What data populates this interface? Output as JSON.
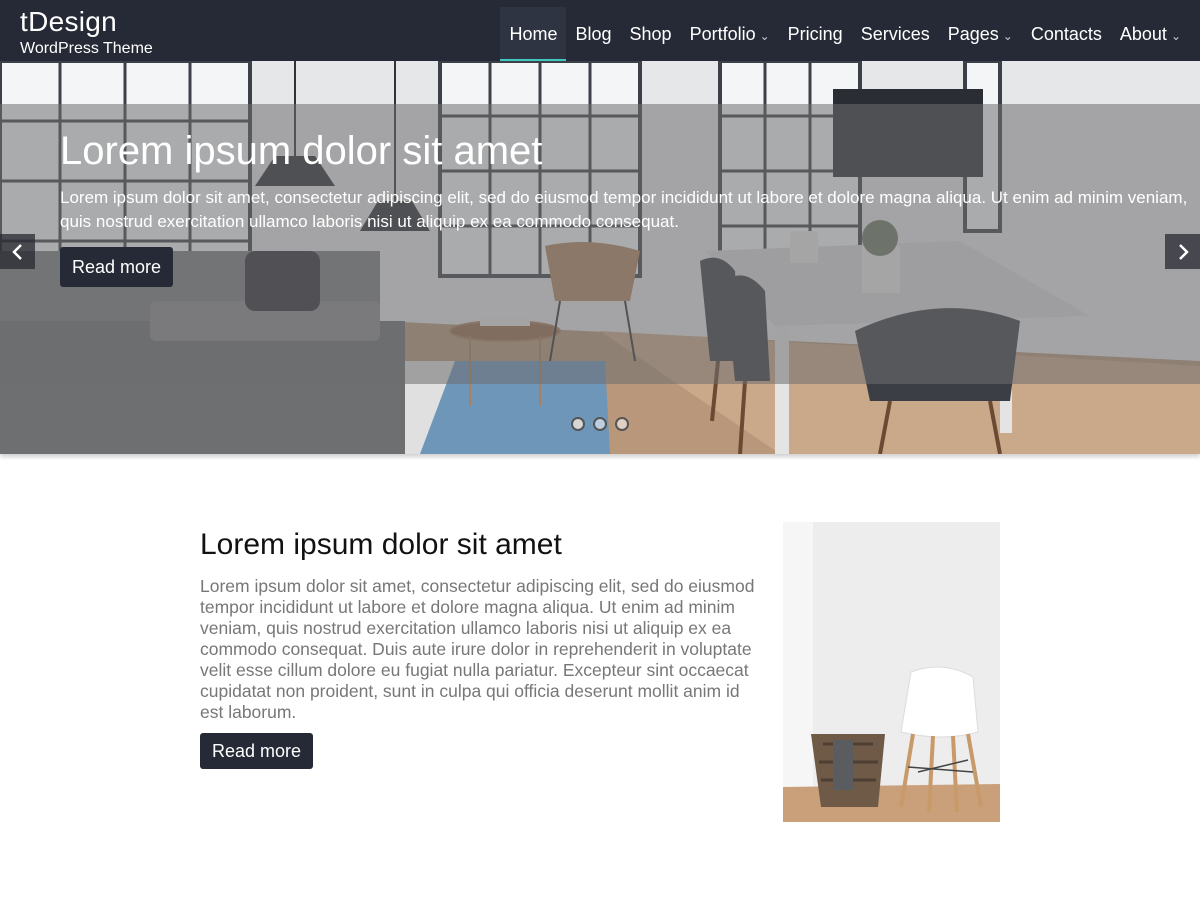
{
  "site": {
    "title": "tDesign",
    "tagline": "WordPress Theme"
  },
  "nav": {
    "items": [
      {
        "label": "Home",
        "active": true,
        "has_dropdown": false
      },
      {
        "label": "Blog",
        "active": false,
        "has_dropdown": false
      },
      {
        "label": "Shop",
        "active": false,
        "has_dropdown": false
      },
      {
        "label": "Portfolio",
        "active": false,
        "has_dropdown": true
      },
      {
        "label": "Pricing",
        "active": false,
        "has_dropdown": false
      },
      {
        "label": "Services",
        "active": false,
        "has_dropdown": false
      },
      {
        "label": "Pages",
        "active": false,
        "has_dropdown": true
      },
      {
        "label": "Contacts",
        "active": false,
        "has_dropdown": false
      },
      {
        "label": "About",
        "active": false,
        "has_dropdown": true
      }
    ],
    "dropdown_icon": "chevron-down-icon"
  },
  "slider": {
    "title": "Lorem ipsum dolor sit amet",
    "text": "Lorem ipsum dolor sit amet, consectetur adipiscing elit, sed do eiusmod tempor incididunt ut labore et dolore magna aliqua. Ut enim ad minim veniam, quis nostrud exercitation ullamco laboris nisi ut aliquip ex ea commodo consequat.",
    "button_label": "Read more",
    "prev_icon": "chevron-left-icon",
    "next_icon": "chevron-right-icon",
    "slide_count": 3,
    "active_slide": 1,
    "image": "living-room-dining-table"
  },
  "feature": {
    "title": "Lorem ipsum dolor sit amet",
    "text": "Lorem ipsum dolor sit amet, consectetur adipiscing elit, sed do eiusmod tempor incididunt ut labore et dolore magna aliqua. Ut enim ad minim veniam, quis nostrud exercitation ullamco laboris nisi ut aliquip ex ea commodo consequat. Duis aute irure dolor in reprehenderit in voluptate velit esse cillum dolore eu fugiat nulla pariatur. Excepteur sint occaecat cupidatat non proident, sunt in culpa qui officia deserunt mollit anim id est laborum.",
    "button_label": "Read more",
    "image": "chair-and-basket"
  },
  "colors": {
    "header_bg": "#262a36",
    "accent": "#3fc7c1",
    "button_bg": "#262a36",
    "body_text": "#777777"
  }
}
